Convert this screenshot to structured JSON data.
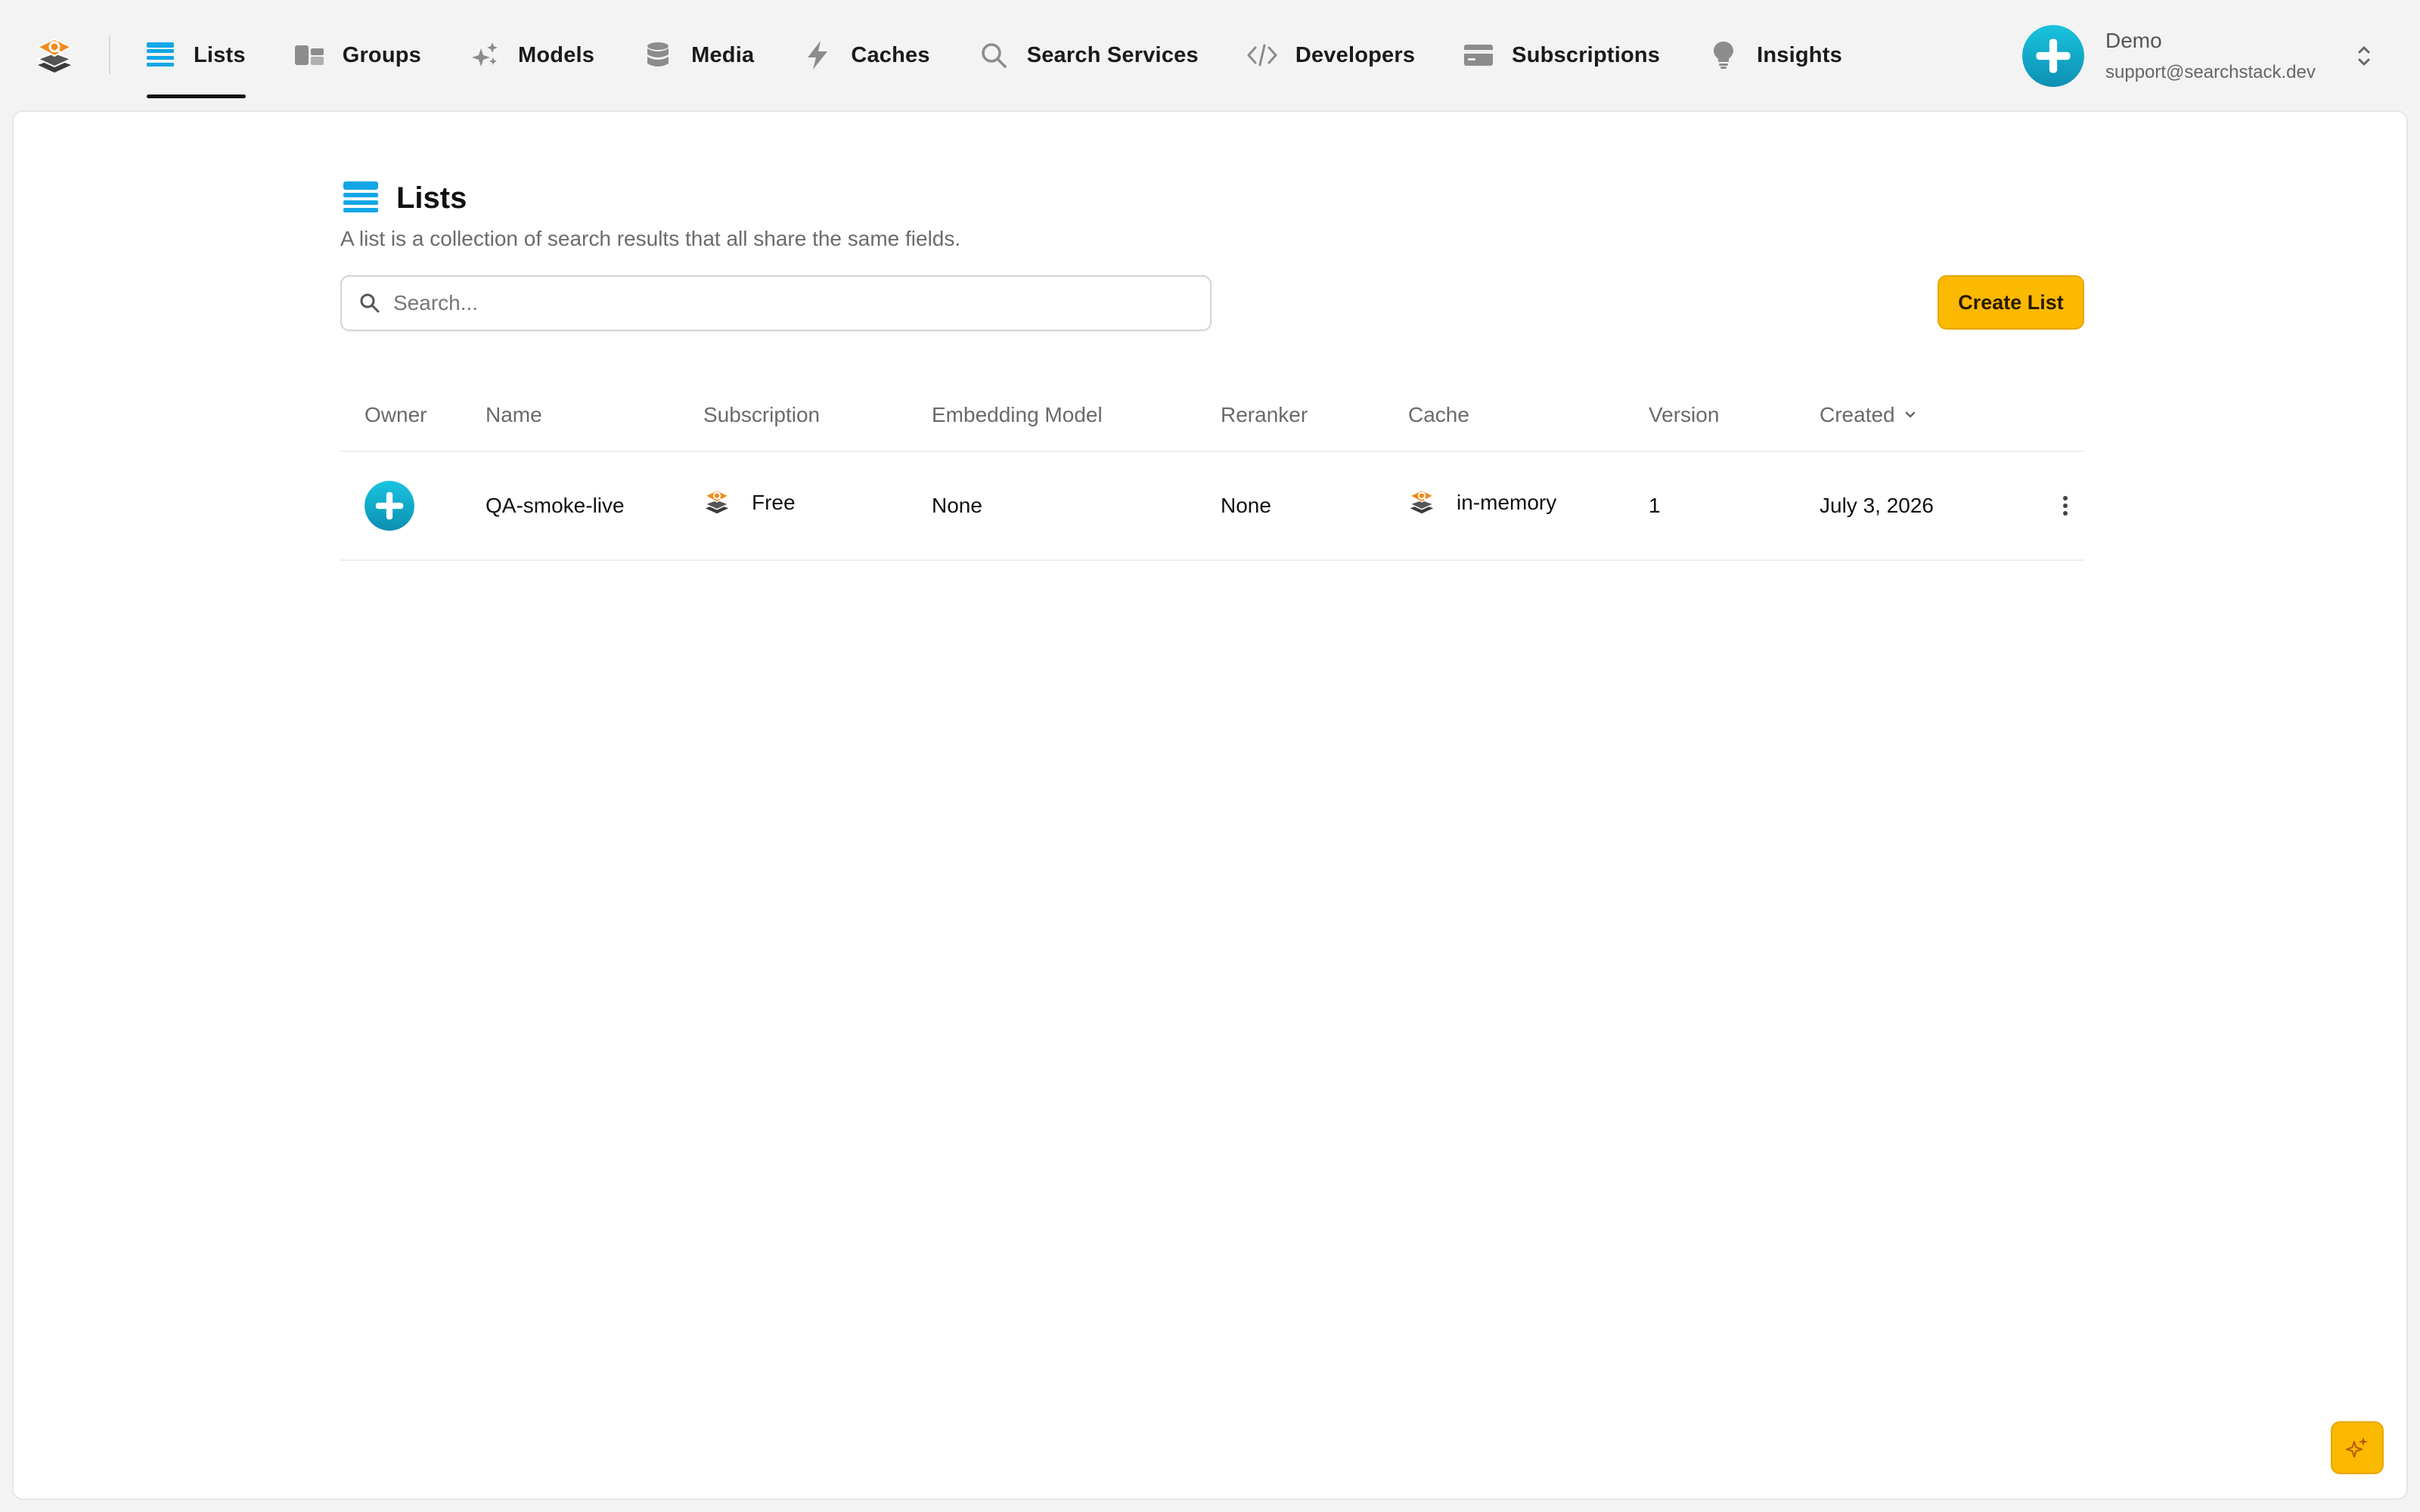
{
  "nav": {
    "items": [
      {
        "label": "Lists",
        "icon": "list-icon",
        "active": true
      },
      {
        "label": "Groups",
        "icon": "groups-icon"
      },
      {
        "label": "Models",
        "icon": "sparkles-icon"
      },
      {
        "label": "Media",
        "icon": "database-icon"
      },
      {
        "label": "Caches",
        "icon": "lightning-icon"
      },
      {
        "label": "Search Services",
        "icon": "search-icon"
      },
      {
        "label": "Developers",
        "icon": "code-icon"
      },
      {
        "label": "Subscriptions",
        "icon": "credit-card-icon"
      },
      {
        "label": "Insights",
        "icon": "lightbulb-icon"
      }
    ]
  },
  "account": {
    "name": "Demo",
    "email": "support@searchstack.dev"
  },
  "page": {
    "title": "Lists",
    "description": "A list is a collection of search results that all share the same fields."
  },
  "search": {
    "placeholder": "Search...",
    "value": ""
  },
  "actions": {
    "create_label": "Create List"
  },
  "table": {
    "columns": [
      "Owner",
      "Name",
      "Subscription",
      "Embedding Model",
      "Reranker",
      "Cache",
      "Version",
      "Created"
    ],
    "sorted_column": "Created",
    "rows": [
      {
        "name": "QA-smoke-live",
        "subscription": "Free",
        "embedding_model": "None",
        "reranker": "None",
        "cache": "in-memory",
        "version": "1",
        "created": "July 3, 2026"
      }
    ]
  },
  "colors": {
    "accent": "#fbb900",
    "brand_orange": "#f28a1c",
    "avatar_teal": "#10a9c8",
    "active_nav_icon": "#12a6e6"
  }
}
